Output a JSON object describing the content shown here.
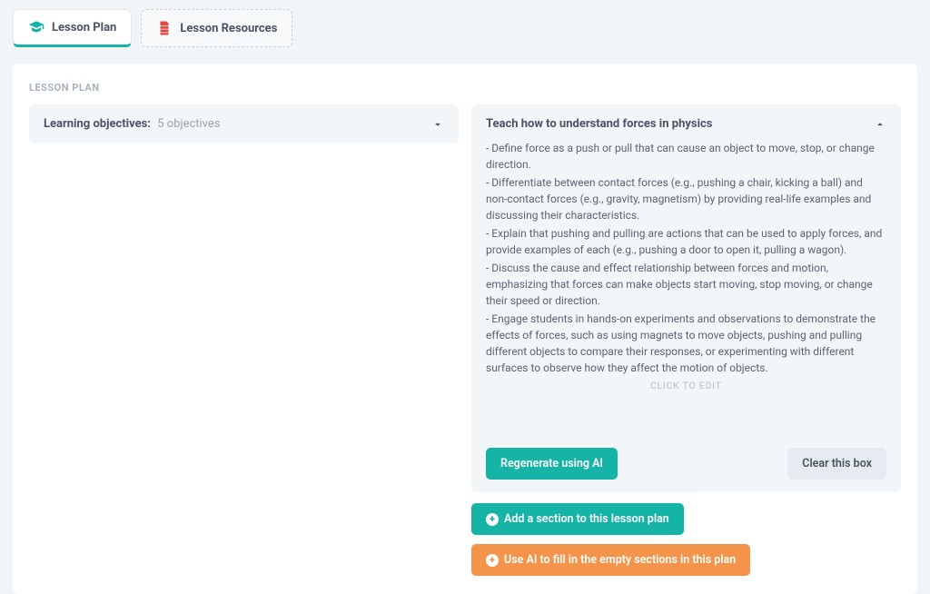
{
  "tabs": {
    "lesson_plan": "Lesson Plan",
    "lesson_resources": "Lesson Resources"
  },
  "section_label": "LESSON PLAN",
  "left_card": {
    "title": "Learning objectives:",
    "sub": "5 objectives"
  },
  "right_card": {
    "title": "Teach how to understand forces in physics",
    "bullets": [
      "- Define force as a push or pull that can cause an object to move, stop, or change direction.",
      "- Differentiate between contact forces (e.g., pushing a chair, kicking a ball) and non-contact forces (e.g., gravity, magnetism) by providing real-life examples and discussing their characteristics.",
      "- Explain that pushing and pulling are actions that can be used to apply forces, and provide examples of each (e.g., pushing a door to open it, pulling a wagon).",
      "- Discuss the cause and effect relationship between forces and motion, emphasizing that forces can make objects start moving, stop moving, or change their speed or direction.",
      "- Engage students in hands-on experiments and observations to demonstrate the effects of forces, such as using magnets to move objects, pushing and pulling different objects to compare their responses, or experimenting with different surfaces to observe how they affect the motion of objects."
    ],
    "click_to_edit": "CLICK TO EDIT",
    "regenerate": "Regenerate using AI",
    "clear": "Clear this box"
  },
  "footer_actions": {
    "add_section": "Add a section to this lesson plan",
    "ai_fill": "Use AI to fill in the empty sections in this plan"
  }
}
